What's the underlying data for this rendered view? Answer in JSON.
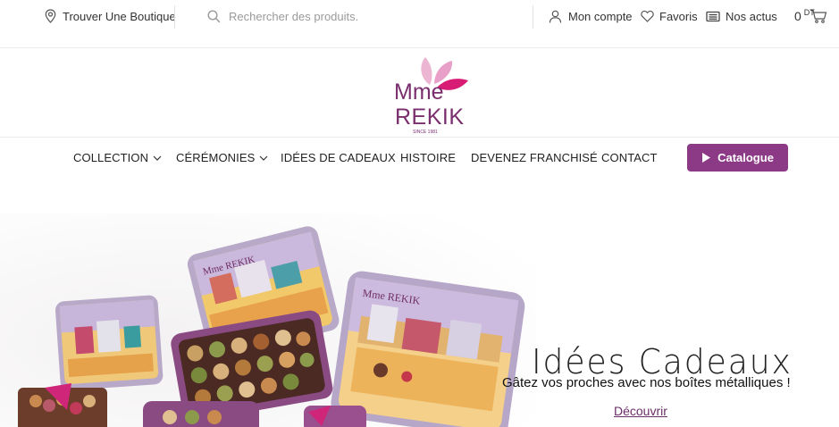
{
  "topbar": {
    "store_label": "Trouver Une Boutique",
    "search_placeholder": "Rechercher des produits.",
    "account_label": "Mon compte",
    "favorites_label": "Favoris",
    "news_label": "Nos actus",
    "cart_count": "0",
    "cart_currency": "DT"
  },
  "logo": {
    "line1": "Mme",
    "line2": "REKIK",
    "tagline": "SINCE 1981"
  },
  "nav": {
    "items": [
      {
        "label": "COLLECTION"
      },
      {
        "label": "CÉRÉMONIES"
      },
      {
        "label": "IDÉES DE CADEAUX"
      },
      {
        "label": "HISTOIRE"
      },
      {
        "label": "DEVENEZ FRANCHISÉ"
      },
      {
        "label": "CONTACT"
      }
    ],
    "catalogue_label": "Catalogue"
  },
  "hero": {
    "title": "Idées Cadeaux",
    "subtitle": "Gâtez vos proches avec nos boîtes métalliques !",
    "cta": "Découvrir"
  },
  "colors": {
    "brand_purple": "#8c3a86",
    "logo_pink": "#e8a3c9",
    "logo_magenta": "#d81b74"
  }
}
